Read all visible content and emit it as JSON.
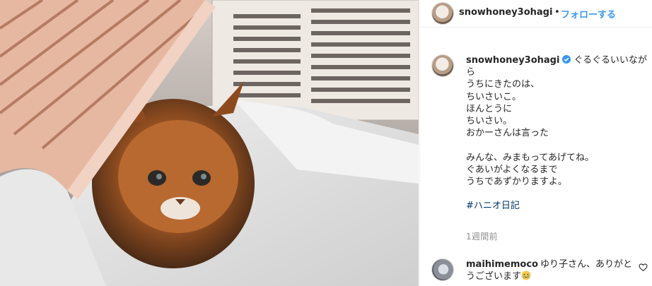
{
  "photo": {
    "alt_subject": "kitten-photo"
  },
  "header": {
    "username": "snowhoney3ohagi",
    "dot": "•",
    "follow_label": "フォローする"
  },
  "caption": {
    "username": "snowhoney3ohagi",
    "first_line": "ぐるぐるいいながら",
    "lines": [
      "うちにきたのは、",
      "ちいさいこ。",
      "ほんとうに",
      "ちいさい。",
      "おかーさんは言った",
      "",
      "みんな、みまもってあげてね。",
      "ぐあいがよくなるまで",
      "うちであずかりますよ。",
      ""
    ],
    "hashtag": "#ハニオ日記"
  },
  "time_ago": "1週間前",
  "comment": {
    "username": "maihimemoco",
    "text": "ゆり子さん、ありがとうございます"
  },
  "icons": {
    "verified": "verified-badge-icon",
    "heart": "heart-outline-icon",
    "emoji": "crying-face-emoji-icon"
  },
  "colors": {
    "follow": "#3897f0",
    "verified": "#3897f0",
    "hashtag": "#00376b",
    "muted": "#8e8e8e"
  }
}
